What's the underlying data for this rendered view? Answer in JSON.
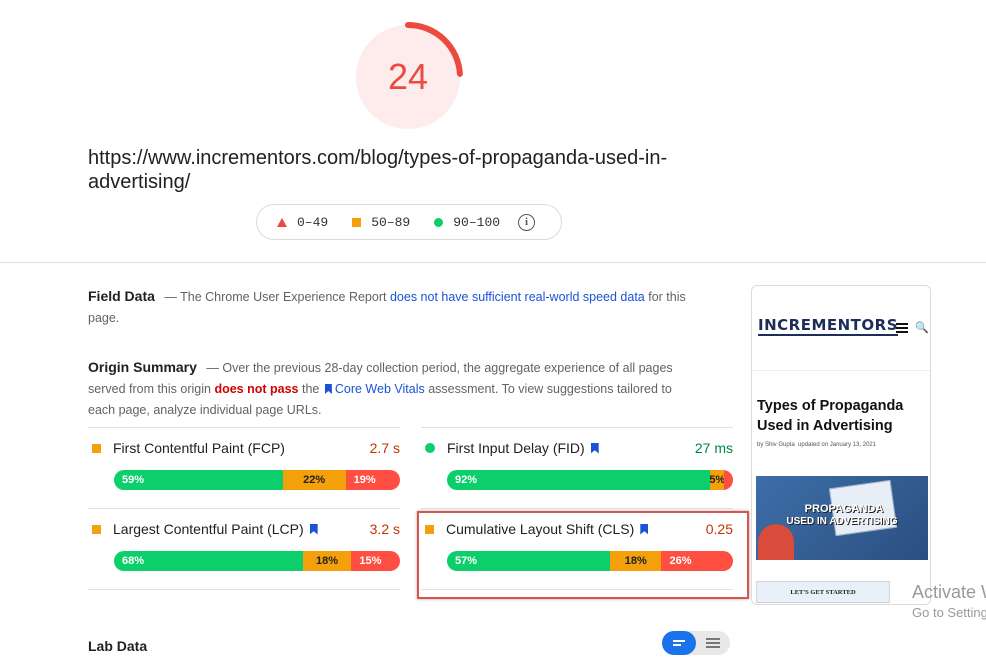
{
  "score": {
    "value": "24",
    "fraction": 0.24,
    "color": "#eb4b3f"
  },
  "url": "https://www.incrementors.com/blog/types-of-propaganda-used-in-advertising/",
  "legend": {
    "poor": "0–49",
    "average": "50–89",
    "good": "90–100",
    "info_icon": "info-icon"
  },
  "field_data": {
    "title": "Field Data",
    "text_before": "— The Chrome User Experience Report",
    "link": "does not have sufficient real-world speed data",
    "text_after": "for this page."
  },
  "origin_summary": {
    "title": "Origin Summary",
    "text_1": "— Over the previous 28-day collection period, the aggregate experience of all pages served from this origin",
    "fail_text": "does not pass",
    "text_2": "the",
    "cwv_link": "Core Web Vitals",
    "text_3": "assessment. To view suggestions tailored to each page, analyze individual page URLs."
  },
  "metrics": [
    {
      "name": "First Contentful Paint (FCP)",
      "value": "2.7 s",
      "status": "average",
      "value_color": "#c33300",
      "core": false,
      "good": "59%",
      "avg": "22%",
      "poor": "19%",
      "good_pct": 59,
      "avg_pct": 22,
      "poor_pct": 19
    },
    {
      "name": "First Input Delay (FID)",
      "value": "27 ms",
      "status": "good",
      "value_color": "#018642",
      "core": true,
      "good": "92%",
      "avg": "5%",
      "poor": "2%",
      "good_pct": 92,
      "avg_pct": 5,
      "poor_pct": 3
    },
    {
      "name": "Largest Contentful Paint (LCP)",
      "value": "3.2 s",
      "status": "average",
      "value_color": "#c33300",
      "core": true,
      "good": "68%",
      "avg": "18%",
      "poor": "15%",
      "good_pct": 66,
      "avg_pct": 17,
      "poor_pct": 17
    },
    {
      "name": "Cumulative Layout Shift (CLS)",
      "value": "0.25",
      "status": "average",
      "value_color": "#c33300",
      "core": true,
      "good": "57%",
      "avg": "18%",
      "poor": "26%",
      "good_pct": 57,
      "avg_pct": 18,
      "poor_pct": 25
    }
  ],
  "lab_data": {
    "title": "Lab Data"
  },
  "thumbnail": {
    "logo": "INCREMENTORS",
    "title": "Types of Propaganda Used in Advertising",
    "author": "by Shiv Gupta",
    "updated": "updated on January 13, 2021",
    "banner_line1": "PROPAGANDA",
    "banner_line2": "USED IN ADVERTISING",
    "button": "LET'S GET STARTED"
  },
  "watermark": {
    "line1": "Activate Windows",
    "line2": "Go to Settings to activate Windows."
  },
  "colors": {
    "good": "#0cce6b",
    "average": "#f4a00a",
    "poor": "#ff4e42",
    "accent": "#1a73e8"
  }
}
